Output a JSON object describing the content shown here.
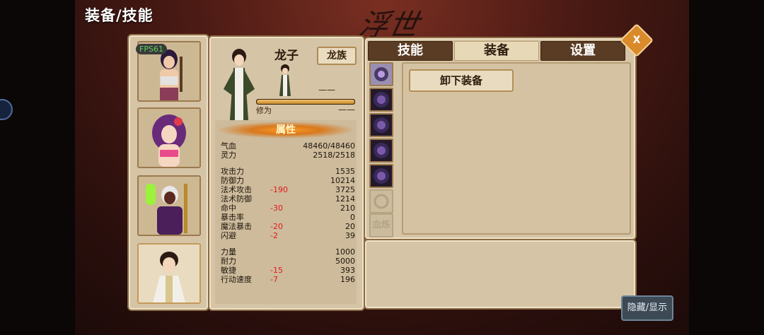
{
  "header": {
    "title": "装备/技能",
    "logo_text": "浮世"
  },
  "fps": "FPS61",
  "character": {
    "name": "龙子",
    "race": "龙族",
    "dash_top": "——",
    "xiuwei_label": "修为",
    "xiuwei_value": "——",
    "xiuwei_progress": 1.0
  },
  "attributes": {
    "header": "属性",
    "rows": [
      {
        "label": "气血",
        "mod": "",
        "value": "48460/48460"
      },
      {
        "label": "灵力",
        "mod": "",
        "value": "2518/2518"
      },
      {
        "label": "攻击力",
        "mod": "",
        "value": "1535"
      },
      {
        "label": "防御力",
        "mod": "",
        "value": "10214"
      },
      {
        "label": "法术攻击",
        "mod": "-190",
        "value": "3725"
      },
      {
        "label": "法术防御",
        "mod": "",
        "value": "1214"
      },
      {
        "label": "命中",
        "mod": "-30",
        "value": "210"
      },
      {
        "label": "暴击率",
        "mod": "",
        "value": "0"
      },
      {
        "label": "魔法暴击",
        "mod": "-20",
        "value": "20"
      },
      {
        "label": "闪避",
        "mod": "-2",
        "value": "39"
      },
      {
        "label": "力量",
        "mod": "",
        "value": "1000"
      },
      {
        "label": "耐力",
        "mod": "",
        "value": "5000"
      },
      {
        "label": "敏捷",
        "mod": "-15",
        "value": "393"
      },
      {
        "label": "行动速度",
        "mod": "-7",
        "value": "196"
      }
    ]
  },
  "tabs": [
    {
      "label": "技能"
    },
    {
      "label": "装备"
    },
    {
      "label": "设置"
    }
  ],
  "close_label": "X",
  "equipment": {
    "unequip_label": "卸下装备",
    "blood_label": "血炼"
  },
  "hide_show_label": "隐藏/显示"
}
